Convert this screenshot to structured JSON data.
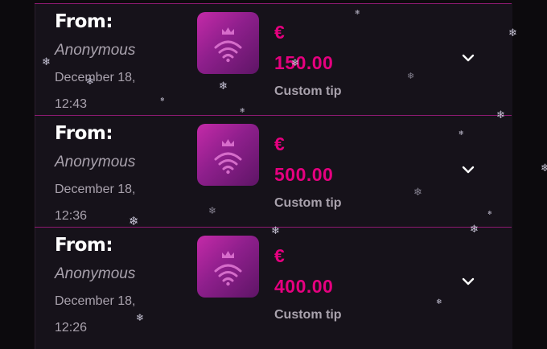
{
  "tips": [
    {
      "from_label": "From:",
      "sender": "Anonymous",
      "date": "December 18,",
      "time": "12:43",
      "currency": "€",
      "amount": "150.00",
      "type": "Custom tip",
      "icon": "crown-wifi-logo"
    },
    {
      "from_label": "From:",
      "sender": "Anonymous",
      "date": "December 18,",
      "time": "12:36",
      "currency": "€",
      "amount": "500.00",
      "type": "Custom tip",
      "icon": "crown-wifi-logo"
    },
    {
      "from_label": "From:",
      "sender": "Anonymous",
      "date": "December 18,",
      "time": "12:26",
      "currency": "€",
      "amount": "400.00",
      "type": "Custom tip",
      "icon": "crown-wifi-logo"
    }
  ],
  "colors": {
    "accent": "#e5007f",
    "divider": "#8e1a72",
    "muted_text": "#a9a2ad",
    "background": "#16121a"
  },
  "decorations": {
    "snowflake_icon": "snowflake-icon"
  }
}
